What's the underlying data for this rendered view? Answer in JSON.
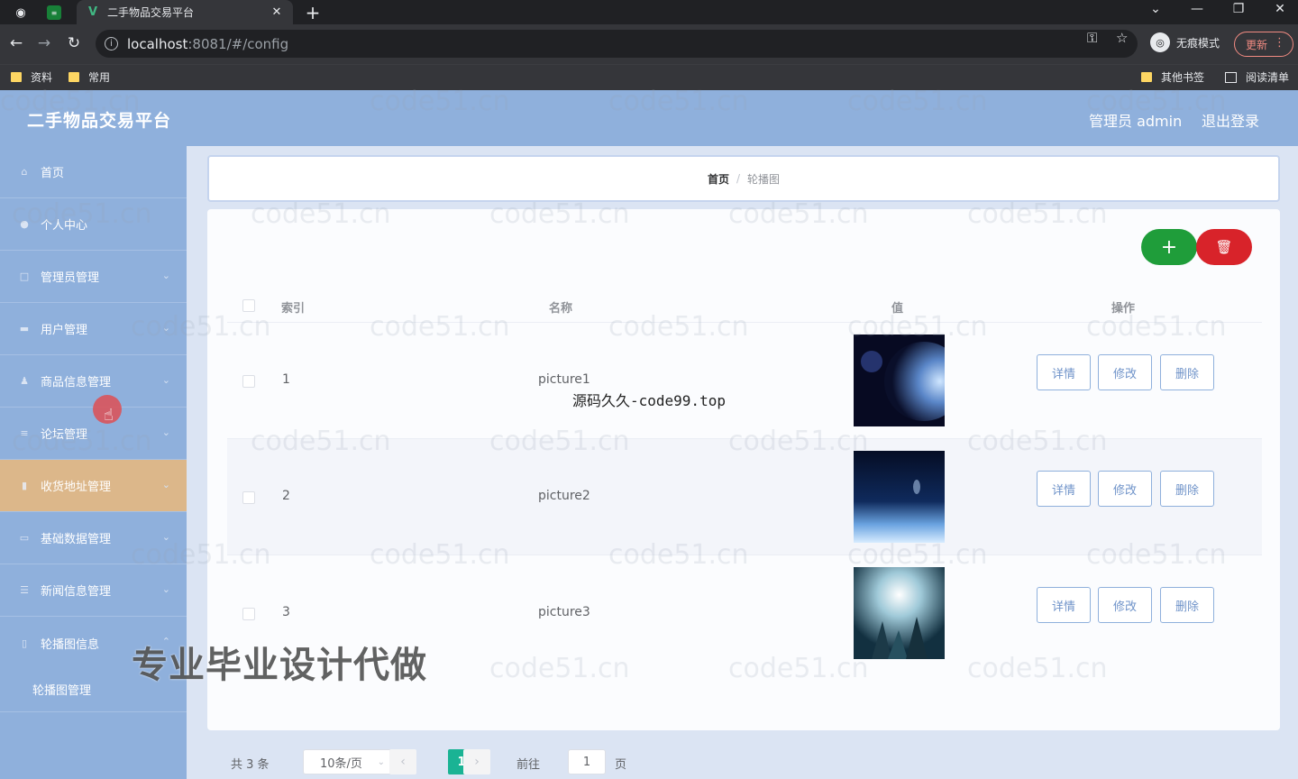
{
  "browser": {
    "tab_title": "二手物品交易平台",
    "url_host": "localhost",
    "url_rest": ":8081/#/config",
    "profile_label": "无痕模式",
    "update_label": "更新",
    "bookmarks": [
      "资料",
      "常用"
    ],
    "bookmarks_right": [
      "其他书签",
      "阅读清单"
    ]
  },
  "app": {
    "title": "二手物品交易平台",
    "user_label": "管理员 admin",
    "logout_label": "退出登录"
  },
  "sidebar": {
    "items": [
      {
        "label": "首页",
        "icon": "home-icon"
      },
      {
        "label": "个人中心",
        "icon": "user-icon"
      },
      {
        "label": "管理员管理",
        "icon": "admin-icon"
      },
      {
        "label": "用户管理",
        "icon": "users-icon"
      },
      {
        "label": "商品信息管理",
        "icon": "goods-icon"
      },
      {
        "label": "论坛管理",
        "icon": "forum-icon"
      },
      {
        "label": "收货地址管理",
        "icon": "chart-icon"
      },
      {
        "label": "基础数据管理",
        "icon": "data-icon"
      },
      {
        "label": "新闻信息管理",
        "icon": "news-icon"
      },
      {
        "label": "轮播图信息",
        "icon": "banner-icon"
      }
    ],
    "sub_item": "轮播图管理",
    "active_index": 6
  },
  "breadcrumb": {
    "home": "首页",
    "separator": "/",
    "current": "轮播图"
  },
  "table": {
    "headers": [
      "索引",
      "名称",
      "值",
      "操作"
    ],
    "rows": [
      {
        "index": "1",
        "name": "picture1"
      },
      {
        "index": "2",
        "name": "picture2"
      },
      {
        "index": "3",
        "name": "picture3"
      }
    ],
    "actions": [
      "详情",
      "修改",
      "删除"
    ]
  },
  "pagination": {
    "total": "共 3 条",
    "page_size": "10条/页",
    "current_page": "1",
    "goto_label": "前往",
    "goto_value": "1",
    "page_suffix": "页"
  },
  "overlays": {
    "watermark": "code51.cn",
    "center_text": "源码久久-code99.top",
    "big_text": "专业毕业设计代做"
  },
  "colors": {
    "header_bg": "#8fb0dc",
    "active_item": "#dcb78a",
    "add_button": "#1f9d3a",
    "delete_button": "#d8232a",
    "page_active": "#1ab394"
  }
}
